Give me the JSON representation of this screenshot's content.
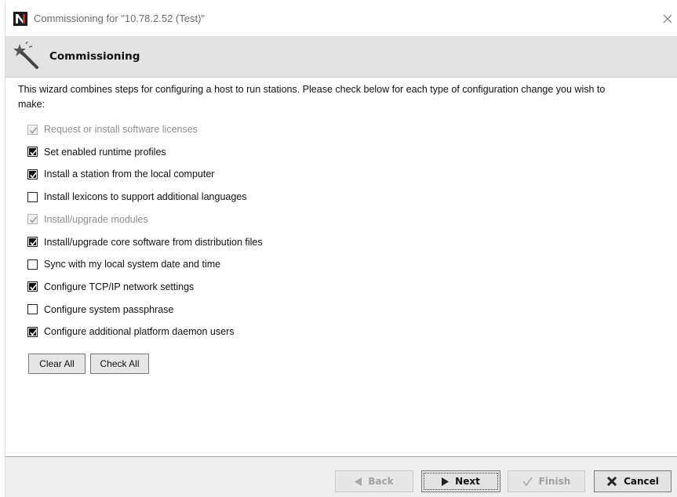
{
  "window": {
    "title": "Commissioning for \"10.78.2.52 (Test)\""
  },
  "header": {
    "title": "Commissioning"
  },
  "intro": {
    "text": "This wizard combines steps for configuring a host to run stations. Please check below for each type of configuration change you wish to make:"
  },
  "options": [
    {
      "label": "Request or install software licenses",
      "checked": true,
      "disabled": true
    },
    {
      "label": "Set enabled runtime profiles",
      "checked": true,
      "disabled": false
    },
    {
      "label": "Install a station from the local computer",
      "checked": true,
      "disabled": false
    },
    {
      "label": "Install lexicons to support additional languages",
      "checked": false,
      "disabled": false
    },
    {
      "label": "Install/upgrade modules",
      "checked": true,
      "disabled": true
    },
    {
      "label": "Install/upgrade core software from distribution files",
      "checked": true,
      "disabled": false
    },
    {
      "label": "Sync with my local system date and time",
      "checked": false,
      "disabled": false
    },
    {
      "label": "Configure TCP/IP network settings",
      "checked": true,
      "disabled": false
    },
    {
      "label": "Configure system passphrase",
      "checked": false,
      "disabled": false
    },
    {
      "label": "Configure additional platform daemon users",
      "checked": true,
      "disabled": false
    }
  ],
  "buttons": {
    "clear_all": "Clear All",
    "check_all": "Check All"
  },
  "footer": {
    "back": "Back",
    "next": "Next",
    "finish": "Finish",
    "cancel": "Cancel"
  },
  "colors": {
    "header_bg": "#e3e3e3",
    "footer_bg": "#eeeeee",
    "logo_red": "#d9261c",
    "logo_dark": "#1a1a1a"
  }
}
